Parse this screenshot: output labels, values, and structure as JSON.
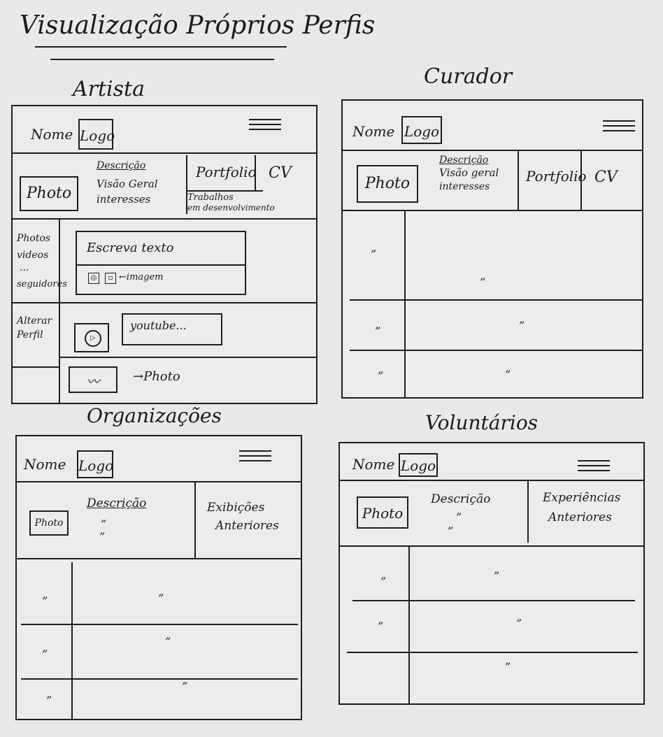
{
  "title": "Visualização Próprios Perfis",
  "common": {
    "nome": "Nome",
    "logo": "Logo",
    "photo": "Photo",
    "mark": "”"
  },
  "artista": {
    "heading": "Artista",
    "descricao_title": "Descrição",
    "descricao_lines": [
      "Visão Geral",
      "interesses"
    ],
    "portfolio": "Portfolio",
    "cv": "CV",
    "trabalhos": [
      "Trabalhos",
      "em desenvolvimento"
    ],
    "side_top": [
      "Photos",
      "videos",
      "...",
      "seguidores"
    ],
    "side_bottom": [
      "Alterar",
      "Perfil"
    ],
    "post_placeholder": "Escreva texto",
    "imagem_label": "imagem",
    "youtube_label": "youtube...",
    "photo_label": "Photo"
  },
  "curador": {
    "heading": "Curador",
    "descricao_title": "Descrição",
    "descricao_lines": [
      "Visão geral",
      "interesses"
    ],
    "portfolio": "Portfolio",
    "cv": "CV"
  },
  "organizacoes": {
    "heading": "Organizações",
    "descricao_title": "Descrição",
    "exibicoes": [
      "Exibições",
      "Anteriores"
    ]
  },
  "voluntarios": {
    "heading": "Voluntários",
    "descricao_title": "Descrição",
    "experiencias": [
      "Experiências",
      "Anteriores"
    ]
  }
}
